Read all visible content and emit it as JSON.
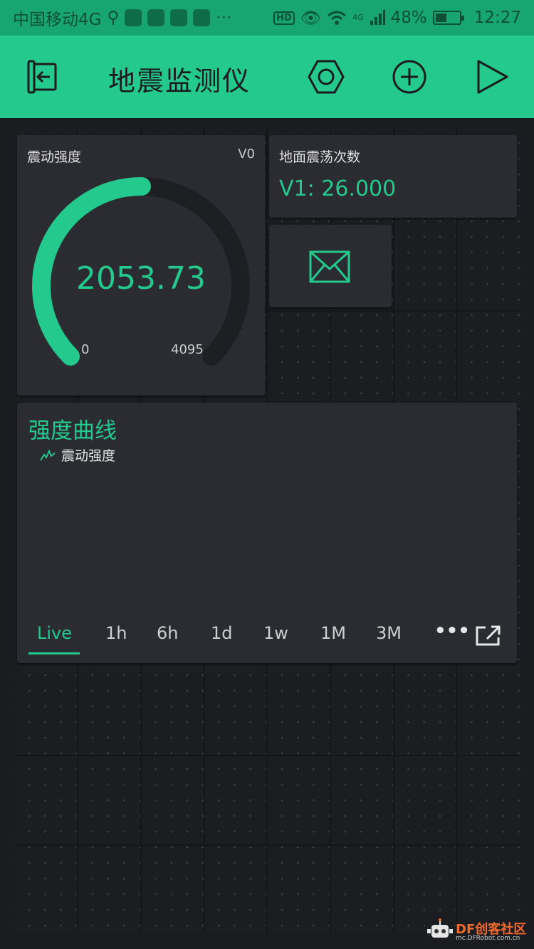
{
  "status_bar": {
    "carrier": "中国移动4G",
    "hd": "HD",
    "network": "4G",
    "battery": "48%",
    "battery_level": 0.48,
    "time": "12:27"
  },
  "app_bar": {
    "title": "地震监测仪",
    "icons": [
      "exit-icon",
      "settings-hex-icon",
      "add-circle-icon",
      "play-icon"
    ]
  },
  "gauge": {
    "label": "震动强度",
    "pin": "V0",
    "value": "2053.73",
    "value_num": 2053.73,
    "min": "0",
    "max": "4095",
    "accent": "#23c98d",
    "track": "#1e1f23"
  },
  "labeled_value": {
    "label": "地面震荡次数",
    "value": "V1: 26.000"
  },
  "email": {
    "icon": "mail-icon"
  },
  "chart": {
    "title": "强度曲线",
    "legend": "震动强度",
    "tabs": [
      "Live",
      "1h",
      "6h",
      "1d",
      "1w",
      "1M",
      "3M"
    ],
    "active_tab": "Live",
    "more_icon": "more-dots-icon",
    "export_icon": "open-external-icon"
  },
  "watermark": {
    "brand": "DF创客社区",
    "url": "mc.DFRobot.com.cn"
  },
  "colors": {
    "accent": "#23c98d",
    "background": "#1b1c20",
    "widget": "#2b2c31",
    "status_bar": "#17a672"
  }
}
